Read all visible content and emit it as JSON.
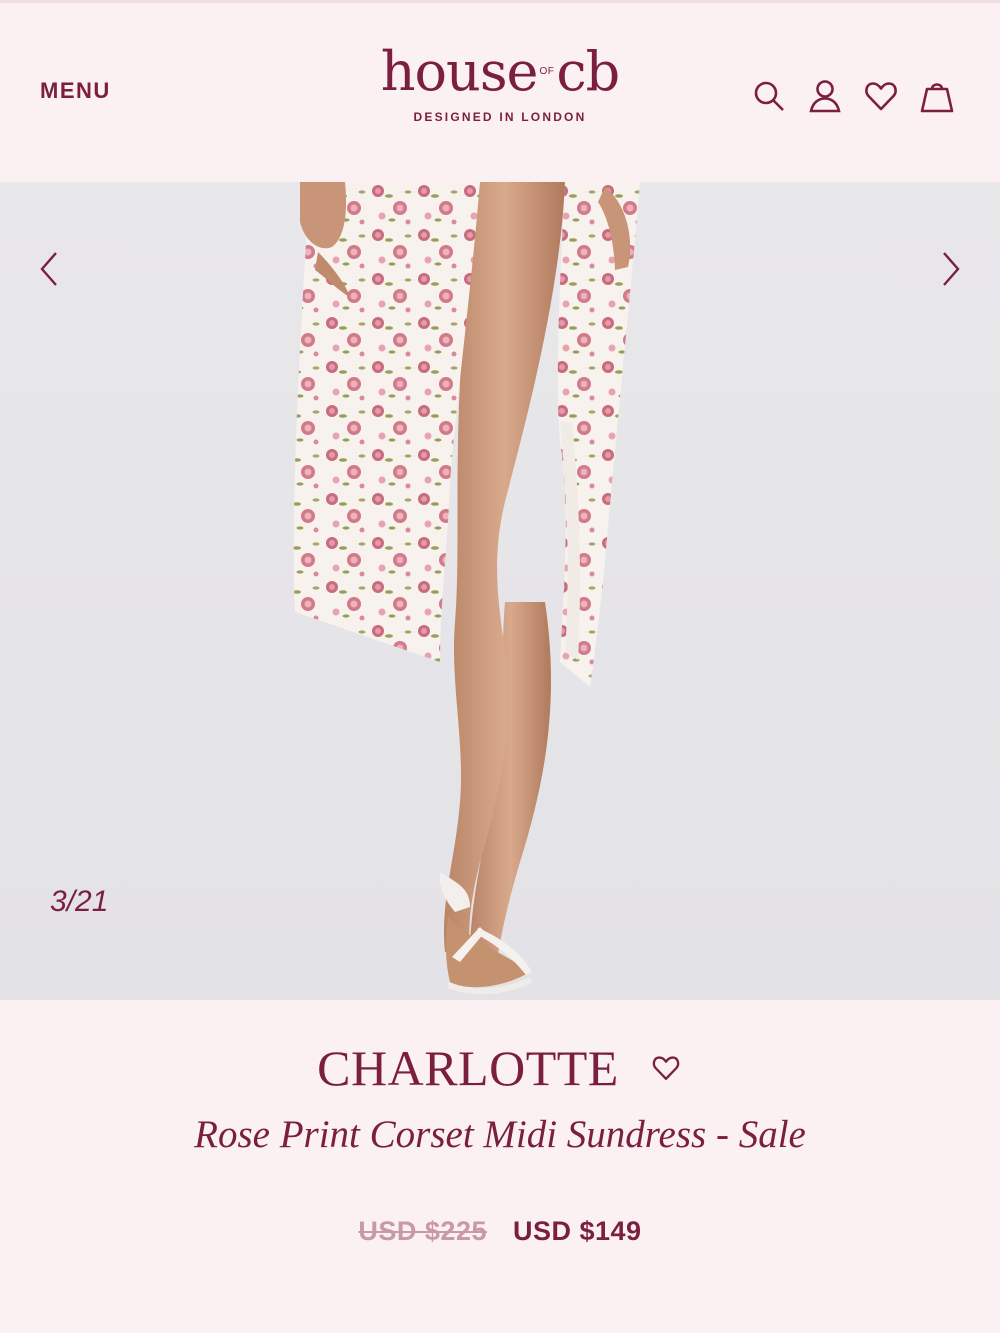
{
  "header": {
    "menu_label": "MENU",
    "logo": {
      "word_left": "house",
      "word_of": "OF",
      "word_right": "cb",
      "tagline": "DESIGNED IN LONDON"
    },
    "icons": [
      "search-icon",
      "account-icon",
      "wishlist-heart-icon",
      "shopping-bag-icon"
    ]
  },
  "gallery": {
    "counter": "3/21",
    "prev_icon": "chevron-left-icon",
    "next_icon": "chevron-right-icon",
    "image_content": "model in white rose-print midi sundress with thigh slit and white thong sandals"
  },
  "product": {
    "name": "CHARLOTTE",
    "subtitle": "Rose Print Corset Midi Sundress - Sale",
    "original_price": "USD $225",
    "sale_price": "USD $149"
  },
  "colors": {
    "brand": "#7a1f3d",
    "background": "#fcf1f2",
    "strike_price": "#c89aa8",
    "photo_backdrop": "#e6e5e8"
  }
}
